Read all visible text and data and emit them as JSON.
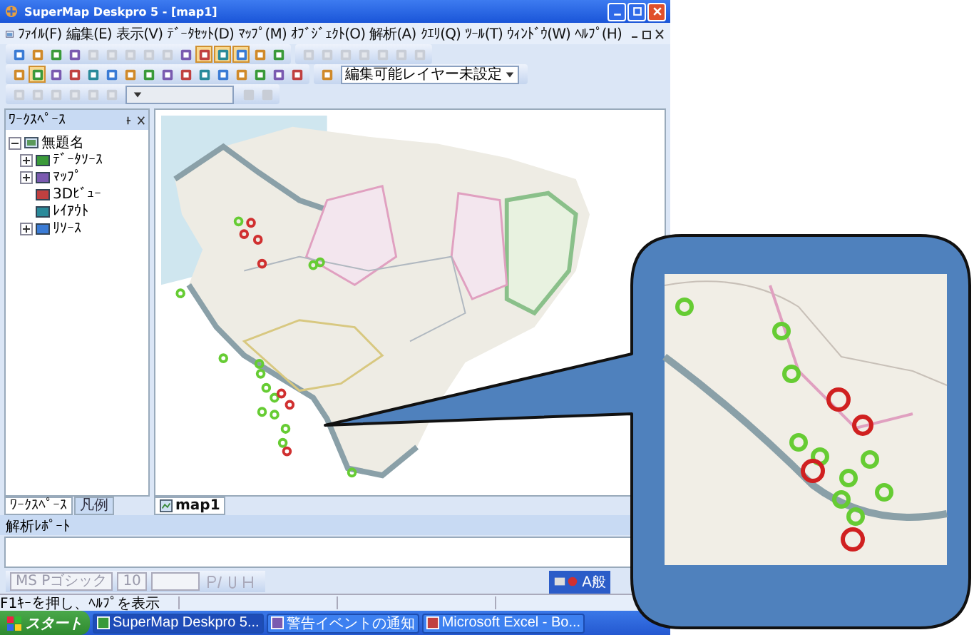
{
  "window": {
    "title": "SuperMap Deskpro 5 - [map1]"
  },
  "menu": [
    "ﾌｧｲﾙ(F)",
    "編集(E)",
    "表示(V)",
    "ﾃﾞｰﾀｾｯﾄ(D)",
    "ﾏｯﾌﾟ(M)",
    "ｵﾌﾞｼﾞｪｸﾄ(O)",
    "解析(A)",
    "ｸｴﾘ(Q)",
    "ﾂｰﾙ(T)",
    "ｳｨﾝﾄﾞｳ(W)",
    "ﾍﾙﾌﾟ(H)"
  ],
  "toolbars": [
    [
      {
        "buttons": [
          {
            "disabled": false,
            "pressed": false
          },
          {
            "disabled": false,
            "pressed": false
          },
          {
            "disabled": false,
            "pressed": false
          },
          {
            "disabled": false,
            "pressed": false
          },
          {
            "disabled": true,
            "pressed": false
          },
          {
            "disabled": true,
            "pressed": false
          },
          {
            "disabled": true,
            "pressed": false
          },
          {
            "disabled": true,
            "pressed": false
          },
          {
            "disabled": true,
            "pressed": false
          },
          {
            "disabled": false,
            "pressed": false
          },
          {
            "disabled": false,
            "pressed": true
          },
          {
            "disabled": false,
            "pressed": true
          },
          {
            "disabled": false,
            "pressed": true
          },
          {
            "disabled": false,
            "pressed": false
          },
          {
            "disabled": false,
            "pressed": false
          }
        ]
      },
      {
        "buttons": [
          {
            "disabled": true,
            "pressed": false
          },
          {
            "disabled": true,
            "pressed": false
          },
          {
            "disabled": true,
            "pressed": false
          },
          {
            "disabled": true,
            "pressed": false
          },
          {
            "disabled": true,
            "pressed": false
          },
          {
            "disabled": true,
            "pressed": false
          },
          {
            "disabled": true,
            "pressed": false
          }
        ]
      }
    ],
    [
      {
        "buttons": [
          {
            "disabled": false,
            "pressed": false
          },
          {
            "disabled": false,
            "pressed": true
          },
          {
            "disabled": false,
            "pressed": false
          },
          {
            "disabled": false,
            "pressed": false
          },
          {
            "disabled": false,
            "pressed": false
          },
          {
            "disabled": false,
            "pressed": false
          },
          {
            "disabled": false,
            "pressed": false
          },
          {
            "disabled": false,
            "pressed": false
          },
          {
            "disabled": false,
            "pressed": false
          },
          {
            "disabled": false,
            "pressed": false
          },
          {
            "disabled": false,
            "pressed": false
          },
          {
            "disabled": false,
            "pressed": false
          },
          {
            "disabled": false,
            "pressed": false
          },
          {
            "disabled": false,
            "pressed": false
          },
          {
            "disabled": false,
            "pressed": false
          },
          {
            "disabled": false,
            "pressed": false
          }
        ]
      },
      {
        "dropdown": {
          "value": "編集可能レイヤー未設定",
          "disabled": false
        },
        "buttons": [
          {
            "disabled": false,
            "pressed": false
          }
        ]
      }
    ],
    [
      {
        "buttons": [
          {
            "disabled": true,
            "pressed": false
          },
          {
            "disabled": true,
            "pressed": false
          },
          {
            "disabled": true,
            "pressed": false
          },
          {
            "disabled": true,
            "pressed": false
          },
          {
            "disabled": true,
            "pressed": false
          },
          {
            "disabled": true,
            "pressed": false
          }
        ],
        "dropdown": {
          "disabled": true
        },
        "tail": [
          {
            "disabled": true,
            "pressed": false
          },
          {
            "disabled": true,
            "pressed": false
          }
        ]
      }
    ]
  ],
  "workspace": {
    "title": "ﾜｰｸｽﾍﾟｰｽ",
    "tree": [
      {
        "label": "無題名",
        "expanded": true,
        "children": [
          {
            "label": "ﾃﾞｰﾀｿｰｽ",
            "expanded": false
          },
          {
            "label": "ﾏｯﾌﾟ",
            "expanded": false
          },
          {
            "label": "3Dﾋﾞｭｰ"
          },
          {
            "label": "ﾚｲｱｳﾄ"
          },
          {
            "label": "ﾘｿｰｽ",
            "expanded": false
          }
        ]
      }
    ]
  },
  "panel_tabs": [
    {
      "label": "ﾜｰｸｽﾍﾟｰｽ",
      "selected": true
    },
    {
      "label": "凡例",
      "selected": false
    }
  ],
  "document_tabs": [
    {
      "label": "map1",
      "selected": true
    }
  ],
  "report": {
    "title": "解析ﾚﾎﾟｰﾄ"
  },
  "format_toolbar": {
    "font": "MS Pゴシック",
    "size": "10"
  },
  "ime_bar": {
    "mode": "A般"
  },
  "status_bar": [
    "F1ｷｰを押し、ﾍﾙﾌﾟを表示"
  ],
  "taskbar": {
    "start": "スタート",
    "items": [
      {
        "label": "SuperMap Deskpro 5...",
        "selected": true
      },
      {
        "label": "警告イベントの通知",
        "selected": false
      },
      {
        "label": "Microsoft Excel - Bo...",
        "selected": false
      }
    ]
  }
}
